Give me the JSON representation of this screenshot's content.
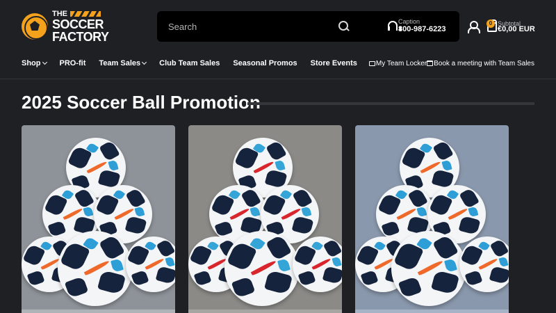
{
  "header": {
    "logo": {
      "line1": "THE",
      "line2": "SOCCER",
      "line3": "FACTORY"
    },
    "search": {
      "placeholder": "Search"
    },
    "phone": {
      "caption": "Caption",
      "number": "800-987-6223"
    },
    "cart": {
      "count": "0",
      "caption": "Subtotal",
      "total": "€0,00 EUR"
    }
  },
  "nav": {
    "items": [
      {
        "label": "Shop",
        "has_dropdown": true
      },
      {
        "label": "PRO-fit",
        "has_dropdown": false
      },
      {
        "label": "Team Sales",
        "has_dropdown": true
      },
      {
        "label": "Club Team Sales",
        "has_dropdown": false
      },
      {
        "label": "Seasonal Promos",
        "has_dropdown": false
      },
      {
        "label": "Store Events",
        "has_dropdown": false
      }
    ],
    "utility": [
      {
        "label": "My Team Locker",
        "icon": "folder-icon"
      },
      {
        "label": "Book a meeting with Team Sales",
        "icon": "calendar-icon"
      }
    ]
  },
  "main": {
    "title": "2025 Soccer Ball Promotion",
    "products": [
      {
        "background": "#8e9399",
        "bar_color": "#aeb3b8",
        "swoosh_color": "#ef6a2a",
        "accent_color": "#2d9fd6"
      },
      {
        "background": "#8b8a87",
        "bar_color": "#a6a5a2",
        "swoosh_color": "#d8262c",
        "accent_color": "#35a5d8"
      },
      {
        "background": "#8a98ad",
        "bar_color": "#a6b3c6",
        "swoosh_color": "#ef6a2a",
        "accent_color": "#2d9fd6"
      }
    ]
  },
  "colors": {
    "page_bg": "#1f2024",
    "search_bg": "#000000",
    "accent": "#f4a21b",
    "divider": "#34363b"
  }
}
